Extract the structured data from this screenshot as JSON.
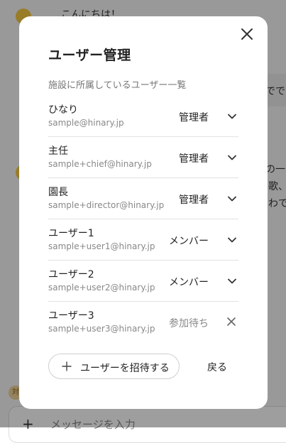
{
  "background": {
    "greeting": "こんにちは！",
    "snippet_1": "でで",
    "snippet_2": "の一",
    "snippet_3": "歌、",
    "snippet_4": "わで",
    "badge": "対",
    "composer_placeholder": "メッセージを入力"
  },
  "modal": {
    "title": "ユーザー管理",
    "subtitle": "施設に所属しているユーザー一覧",
    "users": [
      {
        "name": "ひなり",
        "email": "sample@hinary.jp",
        "role": "管理者"
      },
      {
        "name": "主任",
        "email": "sample+chief@hinary.jp",
        "role": "管理者"
      },
      {
        "name": "園長",
        "email": "sample+director@hinary.jp",
        "role": "管理者"
      },
      {
        "name": "ユーザー1",
        "email": "sample+user1@hinary.jp",
        "role": "メンバー"
      },
      {
        "name": "ユーザー2",
        "email": "sample+user2@hinary.jp",
        "role": "メンバー"
      },
      {
        "name": "ユーザー3",
        "email": "sample+user3@hinary.jp",
        "role": "参加待ち"
      }
    ],
    "invite_label": "ユーザーを招待する",
    "back_label": "戻る"
  }
}
